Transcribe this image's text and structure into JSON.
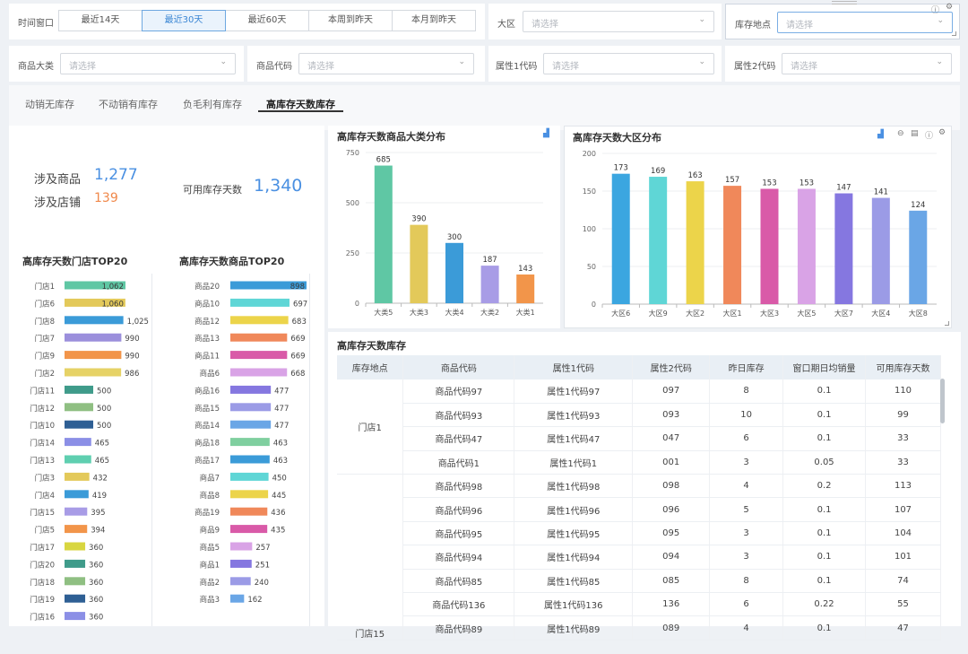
{
  "filters": {
    "time_window": {
      "label": "时间窗口",
      "options": [
        "最近14天",
        "最近30天",
        "最近60天",
        "本周到昨天",
        "本月到昨天"
      ],
      "selected": "最近30天"
    },
    "region": {
      "label": "大区",
      "placeholder": "请选择"
    },
    "location": {
      "label": "库存地点",
      "placeholder": "请选择"
    },
    "category": {
      "label": "商品大类",
      "placeholder": "请选择"
    },
    "code": {
      "label": "商品代码",
      "placeholder": "请选择"
    },
    "attr1": {
      "label": "属性1代码",
      "placeholder": "请选择"
    },
    "attr2": {
      "label": "属性2代码",
      "placeholder": "请选择"
    }
  },
  "tabs": [
    "动销无库存",
    "不动销有库存",
    "负毛利有库存",
    "高库存天数库存"
  ],
  "active_tab": "高库存天数库存",
  "kpi": {
    "products_label": "涉及商品",
    "products_value": "1,277",
    "stores_label": "涉及店铺",
    "stores_value": "139",
    "days_label": "可用库存天数",
    "days_value": "1,340"
  },
  "colors": {
    "accent": "#4a90e2",
    "orange": "#f0884a",
    "tab_underline": "#333333"
  },
  "store_top20": {
    "title": "高库存天数门店TOP20",
    "items": [
      {
        "name": "门店1",
        "value": 1062,
        "label": "1,062",
        "color": "#5fc7a4"
      },
      {
        "name": "门店6",
        "value": 1060,
        "label": "1,060",
        "color": "#e3c95a"
      },
      {
        "name": "门店8",
        "value": 1025,
        "label": "1,025",
        "color": "#3b9bd8"
      },
      {
        "name": "门店7",
        "value": 990,
        "label": "990",
        "color": "#9b8fdc"
      },
      {
        "name": "门店9",
        "value": 990,
        "label": "990",
        "color": "#f2954a"
      },
      {
        "name": "门店2",
        "value": 986,
        "label": "986",
        "color": "#e6d266"
      },
      {
        "name": "门店11",
        "value": 500,
        "label": "500",
        "color": "#3f9b8a"
      },
      {
        "name": "门店12",
        "value": 500,
        "label": "500",
        "color": "#8fbf82"
      },
      {
        "name": "门店10",
        "value": 500,
        "label": "500",
        "color": "#2e5f94"
      },
      {
        "name": "门店14",
        "value": 465,
        "label": "465",
        "color": "#8b8fe6"
      },
      {
        "name": "门店13",
        "value": 465,
        "label": "465",
        "color": "#5fcfb0"
      },
      {
        "name": "门店3",
        "value": 432,
        "label": "432",
        "color": "#e3c95a"
      },
      {
        "name": "门店4",
        "value": 419,
        "label": "419",
        "color": "#3b9bd8"
      },
      {
        "name": "门店15",
        "value": 395,
        "label": "395",
        "color": "#a89ce6"
      },
      {
        "name": "门店5",
        "value": 394,
        "label": "394",
        "color": "#f2954a"
      },
      {
        "name": "门店17",
        "value": 360,
        "label": "360",
        "color": "#d8d640"
      },
      {
        "name": "门店20",
        "value": 360,
        "label": "360",
        "color": "#3f9b8a"
      },
      {
        "name": "门店18",
        "value": 360,
        "label": "360",
        "color": "#8fbf82"
      },
      {
        "name": "门店19",
        "value": 360,
        "label": "360",
        "color": "#2e5f94"
      },
      {
        "name": "门店16",
        "value": 360,
        "label": "360",
        "color": "#8b8fe6"
      }
    ]
  },
  "product_top20": {
    "title": "高库存天数商品TOP20",
    "items": [
      {
        "name": "商品20",
        "value": 898,
        "label": "898",
        "color": "#3b9bd8"
      },
      {
        "name": "商品10",
        "value": 697,
        "label": "697",
        "color": "#5fd6d6"
      },
      {
        "name": "商品12",
        "value": 683,
        "label": "683",
        "color": "#ecd44a"
      },
      {
        "name": "商品13",
        "value": 669,
        "label": "669",
        "color": "#f0885a"
      },
      {
        "name": "商品11",
        "value": 669,
        "label": "669",
        "color": "#d95aa8"
      },
      {
        "name": "商品6",
        "value": 668,
        "label": "668",
        "color": "#d9a3e6"
      },
      {
        "name": "商品16",
        "value": 477,
        "label": "477",
        "color": "#8577e0"
      },
      {
        "name": "商品15",
        "value": 477,
        "label": "477",
        "color": "#9b9be6"
      },
      {
        "name": "商品14",
        "value": 477,
        "label": "477",
        "color": "#6aa6e6"
      },
      {
        "name": "商品18",
        "value": 463,
        "label": "463",
        "color": "#7fcf9f"
      },
      {
        "name": "商品17",
        "value": 463,
        "label": "463",
        "color": "#3b9bd8"
      },
      {
        "name": "商品7",
        "value": 450,
        "label": "450",
        "color": "#5fd6d6"
      },
      {
        "name": "商品8",
        "value": 445,
        "label": "445",
        "color": "#ecd44a"
      },
      {
        "name": "商品19",
        "value": 436,
        "label": "436",
        "color": "#f0885a"
      },
      {
        "name": "商品9",
        "value": 435,
        "label": "435",
        "color": "#d95aa8"
      },
      {
        "name": "商品5",
        "value": 257,
        "label": "257",
        "color": "#d9a3e6"
      },
      {
        "name": "商品1",
        "value": 251,
        "label": "251",
        "color": "#8577e0"
      },
      {
        "name": "商品2",
        "value": 240,
        "label": "240",
        "color": "#9b9be6"
      },
      {
        "name": "商品3",
        "value": 162,
        "label": "162",
        "color": "#6aa6e6"
      }
    ]
  },
  "chart_data": [
    {
      "type": "bar",
      "title": "高库存天数商品大类分布",
      "categories": [
        "大类5",
        "大类3",
        "大类4",
        "大类2",
        "大类1"
      ],
      "values": [
        685,
        390,
        300,
        187,
        143
      ],
      "colors": [
        "#5fc7a4",
        "#e3c95a",
        "#3b9bd8",
        "#a89ce6",
        "#f2954a"
      ],
      "ylim": [
        0,
        750
      ],
      "yticks": [
        0,
        250,
        500,
        750
      ],
      "grid": true
    },
    {
      "type": "bar",
      "title": "高库存天数大区分布",
      "categories": [
        "大区6",
        "大区9",
        "大区2",
        "大区1",
        "大区3",
        "大区5",
        "大区7",
        "大区4",
        "大区8"
      ],
      "values": [
        173,
        169,
        163,
        157,
        153,
        153,
        147,
        141,
        124
      ],
      "colors": [
        "#3ba6e0",
        "#5fd6d6",
        "#ecd44a",
        "#f0885a",
        "#d95aa8",
        "#d9a3e6",
        "#8577e0",
        "#9b9be6",
        "#6aa6e6"
      ],
      "ylim": [
        0,
        200
      ],
      "yticks": [
        0,
        50,
        100,
        150,
        200
      ],
      "grid": true
    }
  ],
  "table": {
    "title": "高库存天数库存",
    "columns": [
      "库存地点",
      "商品代码",
      "属性1代码",
      "属性2代码",
      "昨日库存",
      "窗口期日均销量",
      "可用库存天数"
    ],
    "group1": "门店1",
    "group2": "门店15",
    "rows": [
      [
        "商品代码97",
        "属性1代码97",
        "097",
        "8",
        "0.1",
        "110"
      ],
      [
        "商品代码93",
        "属性1代码93",
        "093",
        "10",
        "0.1",
        "99"
      ],
      [
        "商品代码47",
        "属性1代码47",
        "047",
        "6",
        "0.1",
        "33"
      ],
      [
        "商品代码1",
        "属性1代码1",
        "001",
        "3",
        "0.05",
        "33"
      ],
      [
        "商品代码98",
        "属性1代码98",
        "098",
        "4",
        "0.2",
        "113"
      ],
      [
        "商品代码96",
        "属性1代码96",
        "096",
        "5",
        "0.1",
        "107"
      ],
      [
        "商品代码95",
        "属性1代码95",
        "095",
        "3",
        "0.1",
        "104"
      ],
      [
        "商品代码94",
        "属性1代码94",
        "094",
        "3",
        "0.1",
        "101"
      ],
      [
        "商品代码85",
        "属性1代码85",
        "085",
        "8",
        "0.1",
        "74"
      ],
      [
        "商品代码136",
        "属性1代码136",
        "136",
        "6",
        "0.22",
        "55"
      ],
      [
        "商品代码89",
        "属性1代码89",
        "089",
        "4",
        "0.1",
        "47"
      ]
    ]
  }
}
